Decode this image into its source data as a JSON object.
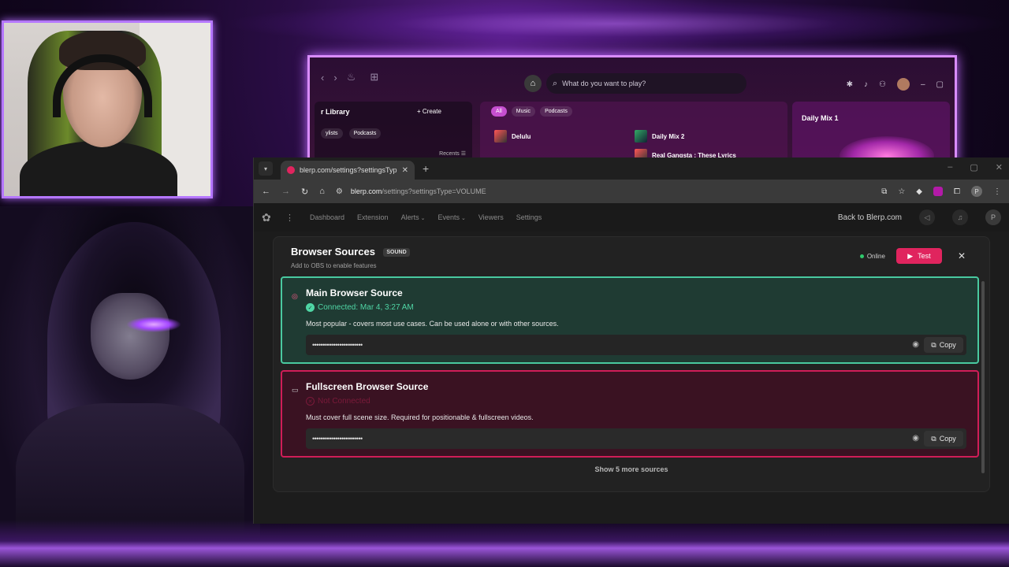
{
  "spotify": {
    "search_placeholder": "What do you want to play?",
    "library_title": "r Library",
    "create_label": "Create",
    "library_chips": [
      "ylists",
      "Podcasts"
    ],
    "recents_label": "Recents",
    "main_chips": [
      "All",
      "Music",
      "Podcasts"
    ],
    "rows": [
      "Delulu",
      "Daily Mix 2",
      "Real Gangsta : These Lyrics"
    ],
    "right_title": "Daily Mix 1"
  },
  "browser": {
    "tab_title": "blerp.com/settings?settingsTyp",
    "url_host": "blerp.com",
    "url_path": "/settings?settingsType=VOLUME",
    "profile_initial": "P"
  },
  "app": {
    "nav": [
      "Dashboard",
      "Extension",
      "Alerts",
      "Events",
      "Viewers",
      "Settings"
    ],
    "back_link": "Back to Blerp.com",
    "avatar_initial": "P"
  },
  "panel": {
    "title": "Browser Sources",
    "badge": "SOUND",
    "subtitle": "Add to OBS to enable features",
    "online_label": "Online",
    "test_label": "Test",
    "show_more": "Show 5 more sources"
  },
  "sources": [
    {
      "title": "Main Browser Source",
      "status": "Connected: Mar 4, 3:27 AM",
      "description": "Most popular - covers most use cases. Can be used alone or with other sources.",
      "masked_url": "••••••••••••••••••••••••",
      "copy_label": "Copy"
    },
    {
      "title": "Fullscreen Browser Source",
      "status": "Not Connected",
      "description": "Must cover full scene size. Required for positionable & fullscreen videos.",
      "masked_url": "••••••••••••••••••••••••",
      "copy_label": "Copy"
    }
  ],
  "colors": {
    "accent": "#e0245e",
    "connected_border": "#49c9a0",
    "disconnected_border": "#d01d58",
    "online": "#2fc96c"
  }
}
